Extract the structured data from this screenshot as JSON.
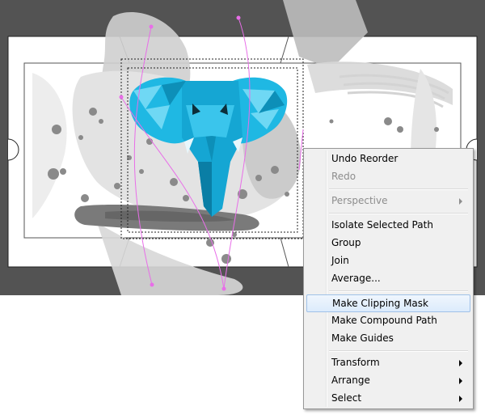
{
  "context_menu": {
    "items": [
      {
        "label": "Undo Reorder",
        "enabled": true,
        "submenu": false,
        "highlighted": false
      },
      {
        "label": "Redo",
        "enabled": false,
        "submenu": false,
        "highlighted": false
      },
      {
        "label": "Perspective",
        "enabled": false,
        "submenu": true,
        "highlighted": false
      },
      {
        "label": "Isolate Selected Path",
        "enabled": true,
        "submenu": false,
        "highlighted": false
      },
      {
        "label": "Group",
        "enabled": true,
        "submenu": false,
        "highlighted": false
      },
      {
        "label": "Join",
        "enabled": true,
        "submenu": false,
        "highlighted": false
      },
      {
        "label": "Average...",
        "enabled": true,
        "submenu": false,
        "highlighted": false
      },
      {
        "label": "Make Clipping Mask",
        "enabled": true,
        "submenu": false,
        "highlighted": true
      },
      {
        "label": "Make Compound Path",
        "enabled": true,
        "submenu": false,
        "highlighted": false
      },
      {
        "label": "Make Guides",
        "enabled": true,
        "submenu": false,
        "highlighted": false
      },
      {
        "label": "Transform",
        "enabled": true,
        "submenu": true,
        "highlighted": false
      },
      {
        "label": "Arrange",
        "enabled": true,
        "submenu": true,
        "highlighted": false
      },
      {
        "label": "Select",
        "enabled": true,
        "submenu": true,
        "highlighted": false
      }
    ]
  },
  "colors": {
    "pasteboard": "#535353",
    "artboard": "#ffffff",
    "elephant": "#1fb8e3",
    "paint": "#8a8a8a",
    "selection": "#e86ee8"
  }
}
